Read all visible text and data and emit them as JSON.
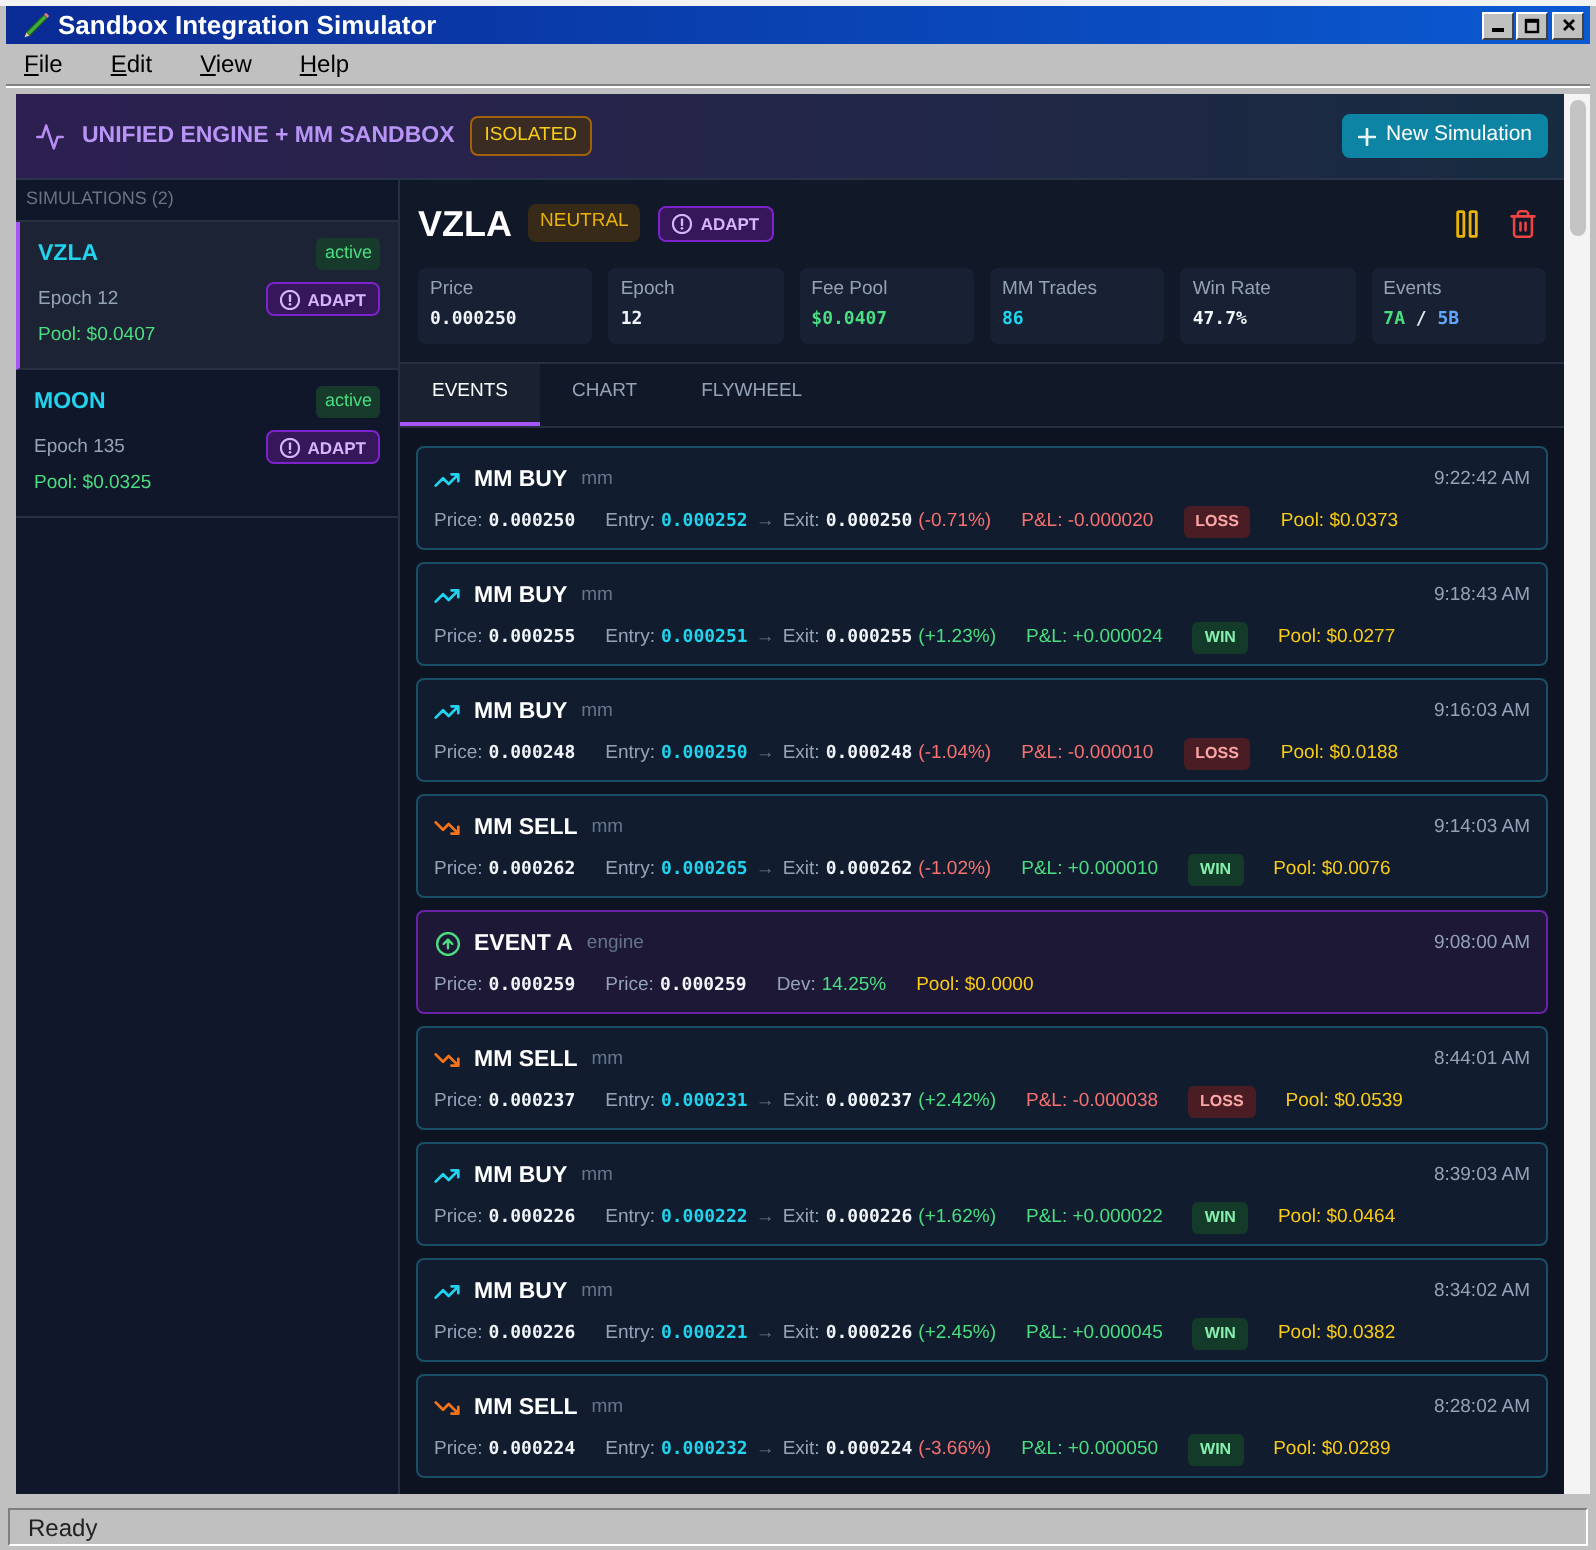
{
  "window": {
    "title": "Sandbox Integration Simulator"
  },
  "menu": [
    "File",
    "Edit",
    "View",
    "Help"
  ],
  "header": {
    "title": "UNIFIED ENGINE + MM SANDBOX",
    "badge": "ISOLATED",
    "button": "New Simulation"
  },
  "sidebar": {
    "heading": "SIMULATIONS (2)",
    "items": [
      {
        "name": "VZLA",
        "status": "active",
        "epoch": "Epoch 12",
        "mode": "ADAPT",
        "pool": "Pool: $0.0407",
        "selected": true
      },
      {
        "name": "MOON",
        "status": "active",
        "epoch": "Epoch 135",
        "mode": "ADAPT",
        "pool": "Pool: $0.0325",
        "selected": false
      }
    ]
  },
  "detail": {
    "name": "VZLA",
    "sentiment": "NEUTRAL",
    "mode": "ADAPT",
    "stats": [
      {
        "label": "Price",
        "kind": "text",
        "value": "0.000250"
      },
      {
        "label": "Epoch",
        "kind": "text",
        "value": "12"
      },
      {
        "label": "Fee Pool",
        "kind": "money",
        "value": "$0.0407"
      },
      {
        "label": "MM Trades",
        "kind": "count",
        "value": "86"
      },
      {
        "label": "Win Rate",
        "kind": "text",
        "value": "47.7%"
      },
      {
        "label": "Events",
        "kind": "split",
        "a": "7A",
        "separator": "/",
        "b": "5B"
      }
    ]
  },
  "tabs": [
    {
      "label": "EVENTS",
      "selected": true
    },
    {
      "label": "CHART",
      "selected": false
    },
    {
      "label": "FLYWHEEL",
      "selected": false
    }
  ],
  "events": [
    {
      "kind": "buy",
      "title": "MM BUY",
      "source": "mm",
      "time": "9:22:42 AM",
      "price_label": "Price:",
      "price": "0.000250",
      "entry_label": "Entry:",
      "entry": "0.000252",
      "arrow": "→",
      "exit_label": "Exit:",
      "exit": "0.000250",
      "change": "(-0.71%)",
      "change_up": false,
      "pnl": "P&L: -0.000020",
      "outcome": "LOSS",
      "win": false,
      "pool": "Pool: $0.0373"
    },
    {
      "kind": "buy",
      "title": "MM BUY",
      "source": "mm",
      "time": "9:18:43 AM",
      "price_label": "Price:",
      "price": "0.000255",
      "entry_label": "Entry:",
      "entry": "0.000251",
      "arrow": "→",
      "exit_label": "Exit:",
      "exit": "0.000255",
      "change": "(+1.23%)",
      "change_up": true,
      "pnl": "P&L: +0.000024",
      "outcome": "WIN",
      "win": true,
      "pool": "Pool: $0.0277"
    },
    {
      "kind": "buy",
      "title": "MM BUY",
      "source": "mm",
      "time": "9:16:03 AM",
      "price_label": "Price:",
      "price": "0.000248",
      "entry_label": "Entry:",
      "entry": "0.000250",
      "arrow": "→",
      "exit_label": "Exit:",
      "exit": "0.000248",
      "change": "(-1.04%)",
      "change_up": false,
      "pnl": "P&L: -0.000010",
      "outcome": "LOSS",
      "win": false,
      "pool": "Pool: $0.0188"
    },
    {
      "kind": "sell",
      "title": "MM SELL",
      "source": "mm",
      "time": "9:14:03 AM",
      "price_label": "Price:",
      "price": "0.000262",
      "entry_label": "Entry:",
      "entry": "0.000265",
      "arrow": "→",
      "exit_label": "Exit:",
      "exit": "0.000262",
      "change": "(-1.02%)",
      "change_up": false,
      "pnl": "P&L: +0.000010",
      "outcome": "WIN",
      "win": true,
      "pool": "Pool: $0.0076"
    },
    {
      "kind": "engine",
      "title": "EVENT A",
      "source": "engine",
      "time": "9:08:00 AM",
      "price_label": "Price:",
      "price": "0.000259",
      "price2_label": "Price:",
      "price2": "0.000259",
      "dev_label": "Dev:",
      "dev": "14.25%",
      "pool": "Pool: $0.0000"
    },
    {
      "kind": "sell",
      "title": "MM SELL",
      "source": "mm",
      "time": "8:44:01 AM",
      "price_label": "Price:",
      "price": "0.000237",
      "entry_label": "Entry:",
      "entry": "0.000231",
      "arrow": "→",
      "exit_label": "Exit:",
      "exit": "0.000237",
      "change": "(+2.42%)",
      "change_up": true,
      "pnl": "P&L: -0.000038",
      "outcome": "LOSS",
      "win": false,
      "pool": "Pool: $0.0539"
    },
    {
      "kind": "buy",
      "title": "MM BUY",
      "source": "mm",
      "time": "8:39:03 AM",
      "price_label": "Price:",
      "price": "0.000226",
      "entry_label": "Entry:",
      "entry": "0.000222",
      "arrow": "→",
      "exit_label": "Exit:",
      "exit": "0.000226",
      "change": "(+1.62%)",
      "change_up": true,
      "pnl": "P&L: +0.000022",
      "outcome": "WIN",
      "win": true,
      "pool": "Pool: $0.0464"
    },
    {
      "kind": "buy",
      "title": "MM BUY",
      "source": "mm",
      "time": "8:34:02 AM",
      "price_label": "Price:",
      "price": "0.000226",
      "entry_label": "Entry:",
      "entry": "0.000221",
      "arrow": "→",
      "exit_label": "Exit:",
      "exit": "0.000226",
      "change": "(+2.45%)",
      "change_up": true,
      "pnl": "P&L: +0.000045",
      "outcome": "WIN",
      "win": true,
      "pool": "Pool: $0.0382"
    },
    {
      "kind": "sell",
      "title": "MM SELL",
      "source": "mm",
      "time": "8:28:02 AM",
      "price_label": "Price:",
      "price": "0.000224",
      "entry_label": "Entry:",
      "entry": "0.000232",
      "arrow": "→",
      "exit_label": "Exit:",
      "exit": "0.000224",
      "change": "(-3.66%)",
      "change_up": false,
      "pnl": "P&L: +0.000050",
      "outcome": "WIN",
      "win": true,
      "pool": "Pool: $0.0289"
    }
  ],
  "status_bar": "Ready"
}
